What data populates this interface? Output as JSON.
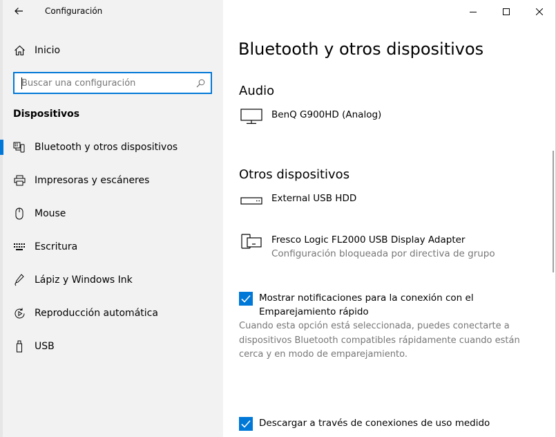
{
  "window": {
    "title": "Configuración"
  },
  "sidebar": {
    "home_label": "Inicio",
    "search_placeholder": "Buscar una configuración",
    "section_title": "Dispositivos",
    "items": [
      {
        "label": "Bluetooth y otros dispositivos",
        "icon": "bluetooth-devices-icon",
        "active": true
      },
      {
        "label": "Impresoras y escáneres",
        "icon": "printer-icon",
        "active": false
      },
      {
        "label": "Mouse",
        "icon": "mouse-icon",
        "active": false
      },
      {
        "label": "Escritura",
        "icon": "keyboard-icon",
        "active": false
      },
      {
        "label": "Lápiz y Windows Ink",
        "icon": "pen-icon",
        "active": false
      },
      {
        "label": "Reproducción automática",
        "icon": "autoplay-icon",
        "active": false
      },
      {
        "label": "USB",
        "icon": "usb-icon",
        "active": false
      }
    ]
  },
  "main": {
    "title": "Bluetooth y otros dispositivos",
    "audio": {
      "heading": "Audio",
      "devices": [
        {
          "name": "BenQ G900HD (Analog)",
          "icon": "monitor-icon"
        }
      ]
    },
    "other": {
      "heading": "Otros dispositivos",
      "devices": [
        {
          "name": "External USB HDD",
          "icon": "drive-icon"
        },
        {
          "name": "Fresco Logic FL2000 USB Display Adapter",
          "status": "Configuración bloqueada por directiva de grupo",
          "icon": "display-adapter-icon"
        }
      ]
    },
    "swift_pair": {
      "checked": true,
      "label": "Mostrar notificaciones para la conexión con el Emparejamiento rápido",
      "description": "Cuando esta opción está seleccionada, puedes conectarte a dispositivos Bluetooth compatibles rápidamente cuando están cerca y en modo de emparejamiento."
    },
    "metered": {
      "checked": true,
      "label": "Descargar a través de conexiones de uso medido"
    }
  },
  "colors": {
    "accent": "#0078d7",
    "sidebar_bg": "#f2f2f2",
    "secondary_text": "#767676"
  }
}
